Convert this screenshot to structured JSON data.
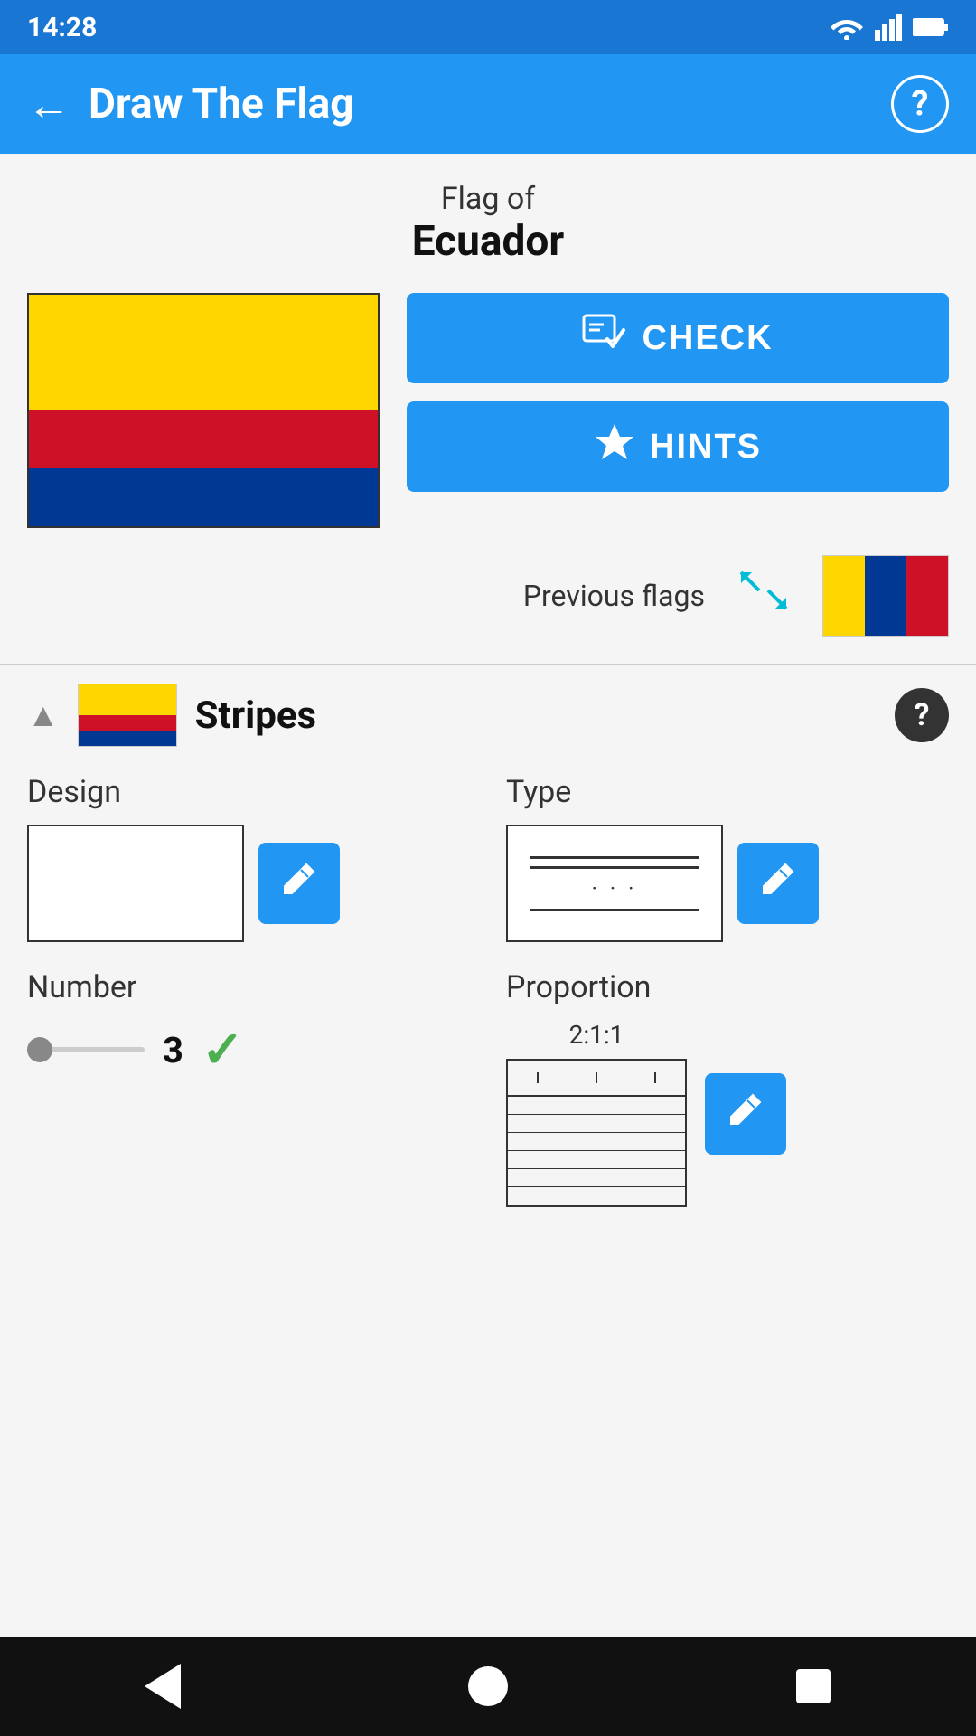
{
  "statusBar": {
    "time": "14:28"
  },
  "appBar": {
    "title": "Draw The Flag",
    "backLabel": "←",
    "helpLabel": "?"
  },
  "flagHeader": {
    "flagOf": "Flag of",
    "country": "Ecuador"
  },
  "buttons": {
    "checkLabel": "CHECK",
    "hintsLabel": "HINTS"
  },
  "previousFlags": {
    "label": "Previous flags"
  },
  "stripesSection": {
    "title": "Stripes",
    "designLabel": "Design",
    "typeLabel": "Type",
    "numberLabel": "Number",
    "proportionLabel": "Proportion",
    "sliderValue": "3",
    "proportionRatio": "2:1:1"
  },
  "nav": {
    "backLabel": "back",
    "homeLabel": "home",
    "recentsLabel": "recents"
  }
}
